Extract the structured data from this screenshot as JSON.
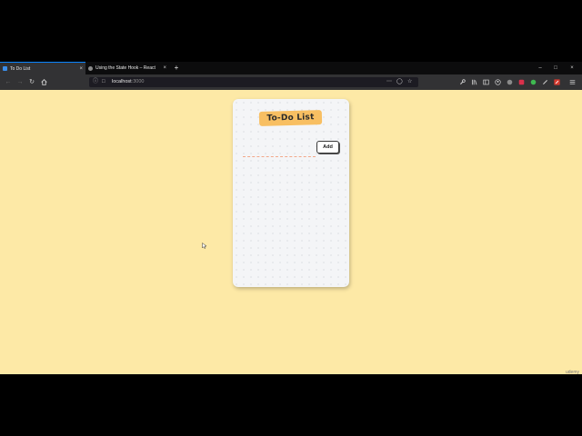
{
  "browser": {
    "tabs": [
      {
        "label": "To Do List",
        "active": true
      },
      {
        "label": "Using the State Hook – React",
        "active": false
      }
    ],
    "new_tab_symbol": "+",
    "close_symbol": "×",
    "window_controls": {
      "minimize": "–",
      "maximize": "□",
      "close": "×"
    },
    "address": {
      "host": "localhost",
      "port": ":3000"
    },
    "nav_icons": [
      "back-arrow-icon",
      "forward-arrow-icon",
      "reload-icon",
      "home-icon"
    ],
    "toolbar_icons": [
      "wrench-icon",
      "library-icon",
      "sidebar-icon",
      "account-icon",
      "extension-icon",
      "extension-icon",
      "extension-icon",
      "pen-icon",
      "extension-icon",
      "menu-icon"
    ]
  },
  "app": {
    "heading": "To-Do List",
    "input_value": "",
    "add_label": "Add"
  },
  "colors": {
    "page_background": "#fde9a6",
    "card_background": "#f4f5f7",
    "heading_highlight": "#f8bf62",
    "input_underline": "#f2a98a",
    "tab_accent": "#0a84ff"
  },
  "watermark": "udemy"
}
